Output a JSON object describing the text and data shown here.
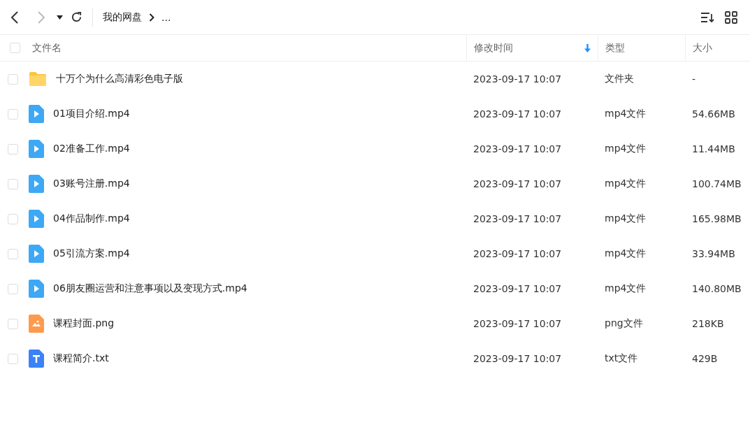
{
  "toolbar": {
    "back_disabled": false,
    "forward_disabled": true,
    "breadcrumb": [
      {
        "label": "我的网盘"
      },
      {
        "label": "..."
      }
    ]
  },
  "table": {
    "select_all_checked": false,
    "columns": [
      {
        "label": "文件名",
        "sorted": false
      },
      {
        "label": "修改时间",
        "sorted": true
      },
      {
        "label": "类型",
        "sorted": false
      },
      {
        "label": "大小",
        "sorted": false
      }
    ],
    "rows": [
      {
        "kind": "folder",
        "checked": false,
        "name": "十万个为什么高清彩色电子版",
        "modified": "2023-09-17 10:07",
        "type": "文件夹",
        "size": "-"
      },
      {
        "kind": "video",
        "checked": false,
        "name": "01项目介绍.mp4",
        "modified": "2023-09-17 10:07",
        "type": "mp4文件",
        "size": "54.66MB"
      },
      {
        "kind": "video",
        "checked": false,
        "name": "02准备工作.mp4",
        "modified": "2023-09-17 10:07",
        "type": "mp4文件",
        "size": "11.44MB"
      },
      {
        "kind": "video",
        "checked": false,
        "name": "03账号注册.mp4",
        "modified": "2023-09-17 10:07",
        "type": "mp4文件",
        "size": "100.74MB"
      },
      {
        "kind": "video",
        "checked": false,
        "name": "04作品制作.mp4",
        "modified": "2023-09-17 10:07",
        "type": "mp4文件",
        "size": "165.98MB"
      },
      {
        "kind": "video",
        "checked": false,
        "name": "05引流方案.mp4",
        "modified": "2023-09-17 10:07",
        "type": "mp4文件",
        "size": "33.94MB"
      },
      {
        "kind": "video",
        "checked": false,
        "name": "06朋友圈运营和注意事项以及变现方式.mp4",
        "modified": "2023-09-17 10:07",
        "type": "mp4文件",
        "size": "140.80MB"
      },
      {
        "kind": "image",
        "checked": false,
        "name": "课程封面.png",
        "modified": "2023-09-17 10:07",
        "type": "png文件",
        "size": "218KB"
      },
      {
        "kind": "text",
        "checked": false,
        "name": "课程简介.txt",
        "modified": "2023-09-17 10:07",
        "type": "txt文件",
        "size": "429B"
      }
    ]
  }
}
